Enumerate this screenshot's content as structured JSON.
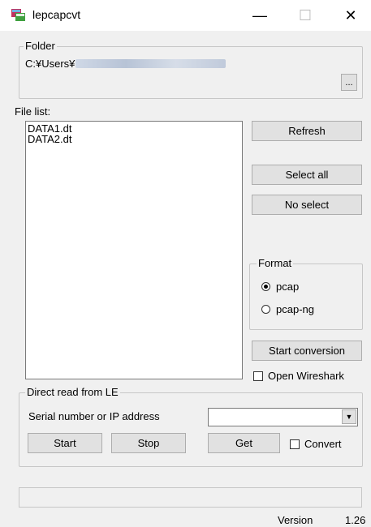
{
  "window": {
    "title": "lepcapcvt",
    "minimize_glyph": "—",
    "maximize_glyph": "☐",
    "close_glyph": "✕"
  },
  "folder": {
    "legend": "Folder",
    "path_prefix": "C:¥Users¥",
    "browse_label": "..."
  },
  "file_list": {
    "label": "File list:",
    "items": [
      "DATA1.dt",
      "DATA2.dt"
    ]
  },
  "buttons": {
    "refresh": "Refresh",
    "select_all": "Select all",
    "no_select": "No select",
    "start_conversion": "Start conversion"
  },
  "format": {
    "legend": "Format",
    "options": [
      "pcap",
      "pcap-ng"
    ],
    "selected": "pcap"
  },
  "open_wireshark": {
    "label": "Open Wireshark",
    "checked": false
  },
  "direct_read": {
    "legend": "Direct read from LE",
    "serial_label": "Serial number or IP address",
    "serial_value": "",
    "start_label": "Start",
    "stop_label": "Stop",
    "get_label": "Get",
    "convert_label": "Convert",
    "convert_checked": false
  },
  "version": {
    "label": "Version",
    "number": "1.26"
  }
}
